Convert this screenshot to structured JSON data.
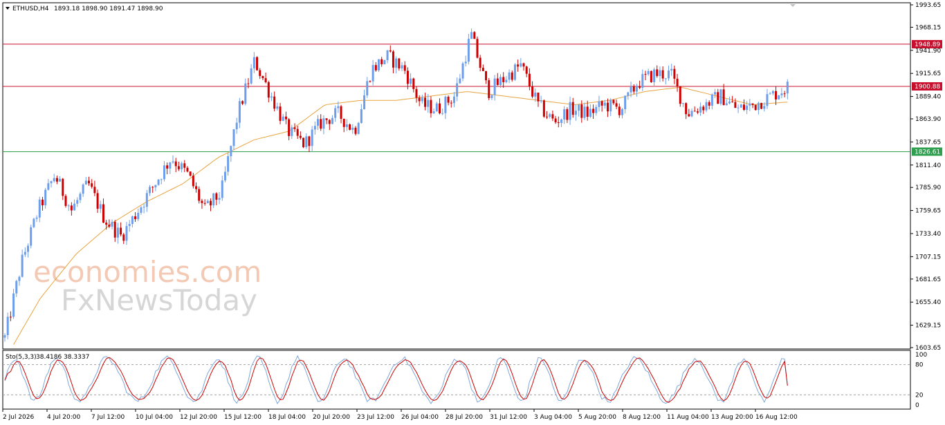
{
  "header": {
    "symbol": "ETHUSD,H4",
    "ohlc": "1893.18 1898.90 1891.47 1898.90"
  },
  "indicator": {
    "name": "Sto(5,3,3)",
    "values": "38.4186 38.3337",
    "scale_labels": [
      "100",
      "80",
      "20",
      "0"
    ]
  },
  "price_axis_labels": [
    "1993.65",
    "1968.15",
    "1941.90",
    "1915.65",
    "1889.40",
    "1863.90",
    "1837.65",
    "1811.40",
    "1785.90",
    "1759.65",
    "1733.40",
    "1707.15",
    "1681.65",
    "1655.40",
    "1629.15",
    "1603.65"
  ],
  "levels": [
    {
      "label": "1948.89",
      "value": 1948.89,
      "color": "#c8102e"
    },
    {
      "label": "1900.88",
      "value": 1900.88,
      "color": "#c8102e"
    },
    {
      "label": "1826.61",
      "value": 1826.61,
      "color": "#2e9e4f"
    }
  ],
  "time_labels": [
    "2 Jul 2026",
    "4 Jul 20:00",
    "7 Jul 12:00",
    "10 Jul 04:00",
    "12 Jul 20:00",
    "15 Jul 12:00",
    "18 Jul 04:00",
    "20 Jul 20:00",
    "23 Jul 12:00",
    "26 Jul 04:00",
    "28 Jul 20:00",
    "31 Jul 12:00",
    "3 Aug 04:00",
    "5 Aug 20:00",
    "8 Aug 12:00",
    "11 Aug 04:00",
    "13 Aug 20:00",
    "16 Aug 12:00"
  ],
  "watermark": {
    "line1": "economies.com",
    "line2": "FxNewsToday"
  },
  "colors": {
    "bull": "#6d9eeb",
    "bear": "#cc0000",
    "ma": "#e8a33d",
    "stoch_main": "#7da7d9",
    "stoch_signal": "#cc0000"
  },
  "chart_data": {
    "type": "candlestick",
    "symbol": "ETHUSD",
    "timeframe": "H4",
    "ylim": [
      1603.65,
      1993.65
    ],
    "anchors": [
      1615,
      1700,
      1760,
      1800,
      1760,
      1790,
      1750,
      1730,
      1760,
      1790,
      1820,
      1800,
      1760,
      1780,
      1870,
      1930,
      1890,
      1850,
      1835,
      1860,
      1870,
      1850,
      1920,
      1935,
      1920,
      1880,
      1875,
      1890,
      1960,
      1895,
      1910,
      1925,
      1880,
      1860,
      1875,
      1870,
      1880,
      1875,
      1905,
      1915,
      1915,
      1870,
      1880,
      1890,
      1875,
      1880,
      1890,
      1900
    ],
    "ma_anchors": [
      1590,
      1660,
      1710,
      1745,
      1770,
      1790,
      1820,
      1840,
      1850,
      1880,
      1885,
      1885,
      1890,
      1895,
      1890,
      1885,
      1880,
      1885,
      1895,
      1900,
      1890,
      1880,
      1883
    ],
    "stoch": {
      "k_last": 38.4186,
      "d_last": 38.3337,
      "levels": [
        20,
        80
      ]
    }
  }
}
